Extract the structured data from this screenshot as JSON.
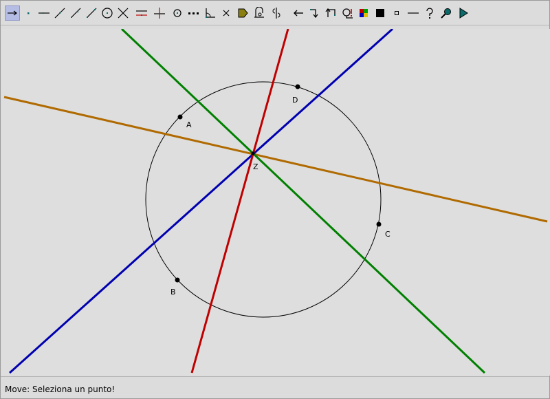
{
  "toolbar": {
    "tools": [
      {
        "name": "move-tool",
        "active": true
      },
      {
        "name": "point-tool"
      },
      {
        "name": "line-tool"
      },
      {
        "name": "segment-tool"
      },
      {
        "name": "ray-tool"
      },
      {
        "name": "vector-tool"
      },
      {
        "name": "circle-tool"
      },
      {
        "name": "intersection-tool"
      },
      {
        "name": "parallel-tool"
      },
      {
        "name": "perpendicular-tool"
      },
      {
        "name": "midpoint-tool"
      },
      {
        "name": "perpendicular-bisector-tool"
      },
      {
        "name": "angle-bisector-tool"
      },
      {
        "name": "delete-tool"
      },
      {
        "name": "polygon-tool"
      },
      {
        "name": "symmetry-tool"
      },
      {
        "name": "reflection-tool"
      },
      {
        "name": "undo-tool"
      },
      {
        "name": "redo-tool"
      },
      {
        "name": "rotate-tool"
      },
      {
        "name": "macro-tool"
      },
      {
        "name": "color-tool"
      },
      {
        "name": "fill-tool"
      },
      {
        "name": "point-style-tool"
      },
      {
        "name": "line-style-tool"
      },
      {
        "name": "help-tool"
      },
      {
        "name": "zoom-tool"
      },
      {
        "name": "play-tool"
      }
    ]
  },
  "colors": {
    "circle": "#000000",
    "red_line": "#c00000",
    "green_line": "#008000",
    "blue_line": "#0000b0",
    "orange_line": "#b06a00"
  },
  "geometry": {
    "points": [
      {
        "label": "A"
      },
      {
        "label": "B"
      },
      {
        "label": "C"
      },
      {
        "label": "D"
      },
      {
        "label": "Z"
      }
    ]
  },
  "status": {
    "message": "Move: Seleziona un punto!"
  }
}
